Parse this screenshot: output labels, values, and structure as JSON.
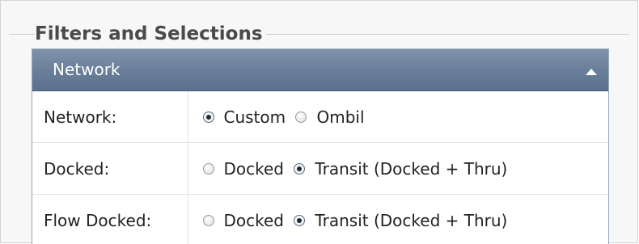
{
  "fieldset": {
    "legend": "Filters and Selections"
  },
  "panel": {
    "title": "Network",
    "collapse_icon": "triangle-up-icon"
  },
  "rows": [
    {
      "label": "Network:",
      "options": [
        {
          "label": "Custom",
          "checked": true
        },
        {
          "label": "Ombil",
          "checked": false
        }
      ]
    },
    {
      "label": "Docked:",
      "options": [
        {
          "label": "Docked",
          "checked": false
        },
        {
          "label": "Transit (Docked + Thru)",
          "checked": true
        }
      ]
    },
    {
      "label": "Flow Docked:",
      "options": [
        {
          "label": "Docked",
          "checked": false
        },
        {
          "label": "Transit (Docked + Thru)",
          "checked": true
        }
      ]
    }
  ]
}
